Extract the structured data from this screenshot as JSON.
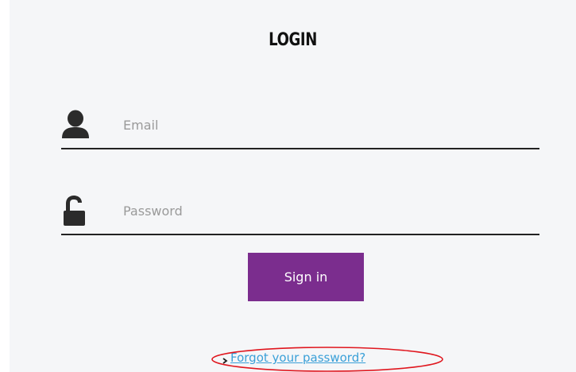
{
  "login": {
    "title": "LOGIN",
    "email": {
      "placeholder": "Email",
      "value": "",
      "icon": "user-icon"
    },
    "password": {
      "placeholder": "Password",
      "value": "",
      "icon": "unlocked-padlock-icon"
    },
    "signin_label": "Sign in",
    "forgot_label": "Forgot your password?"
  },
  "colors": {
    "accent": "#7b2d8e",
    "link": "#3aa0d8",
    "highlight": "#e0161e",
    "panel_bg": "#f5f6f8"
  }
}
